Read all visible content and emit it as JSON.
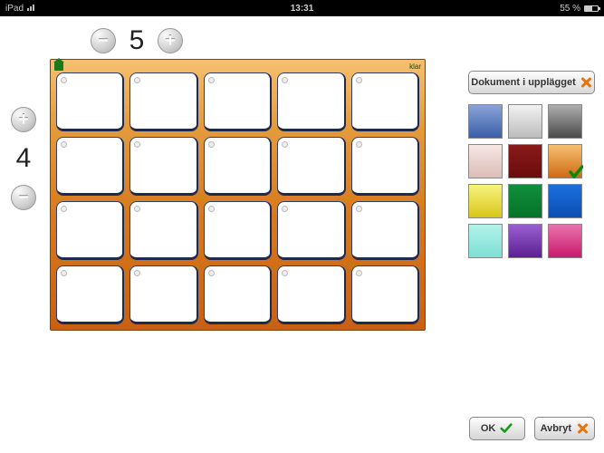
{
  "statusbar": {
    "device": "iPad",
    "time": "13:31",
    "battery": "55 %"
  },
  "controls": {
    "columns": 5,
    "rows": 4,
    "plus_glyph": "+",
    "minus_glyph": "−"
  },
  "board": {
    "klar_label": "klar"
  },
  "grid": {
    "cols": 5,
    "rows": 4
  },
  "docs_button": {
    "label": "Dokument i upplägget"
  },
  "palette": {
    "selected_index": 5,
    "swatches": [
      {
        "name": "blue",
        "bg": "linear-gradient(180deg,#8aa4d8,#3b5da8)"
      },
      {
        "name": "silver",
        "bg": "linear-gradient(180deg,#f2f2f2,#bcbcbc)"
      },
      {
        "name": "charcoal",
        "bg": "linear-gradient(180deg,#aeaeae,#4a4a4a)"
      },
      {
        "name": "blush",
        "bg": "linear-gradient(180deg,#f7e7e5,#dcbdb7)"
      },
      {
        "name": "maroon",
        "bg": "linear-gradient(180deg,#8a1a1a,#6b0c0c)"
      },
      {
        "name": "orange",
        "bg": "linear-gradient(180deg,#f6c070,#cf6a14)"
      },
      {
        "name": "yellow",
        "bg": "linear-gradient(180deg,#f7f47e,#d9c61a)"
      },
      {
        "name": "green",
        "bg": "linear-gradient(180deg,#0f8f3a,#06732a)"
      },
      {
        "name": "royal-blue",
        "bg": "linear-gradient(180deg,#1b6fe0,#0c4fb1)"
      },
      {
        "name": "teal",
        "bg": "linear-gradient(180deg,#b2f2ea,#7ee0d4)"
      },
      {
        "name": "purple",
        "bg": "linear-gradient(180deg,#9a5fd0,#5b1f92)"
      },
      {
        "name": "magenta",
        "bg": "linear-gradient(180deg,#e973ac,#c81a6b)"
      }
    ]
  },
  "buttons": {
    "ok": "OK",
    "cancel": "Avbryt"
  }
}
